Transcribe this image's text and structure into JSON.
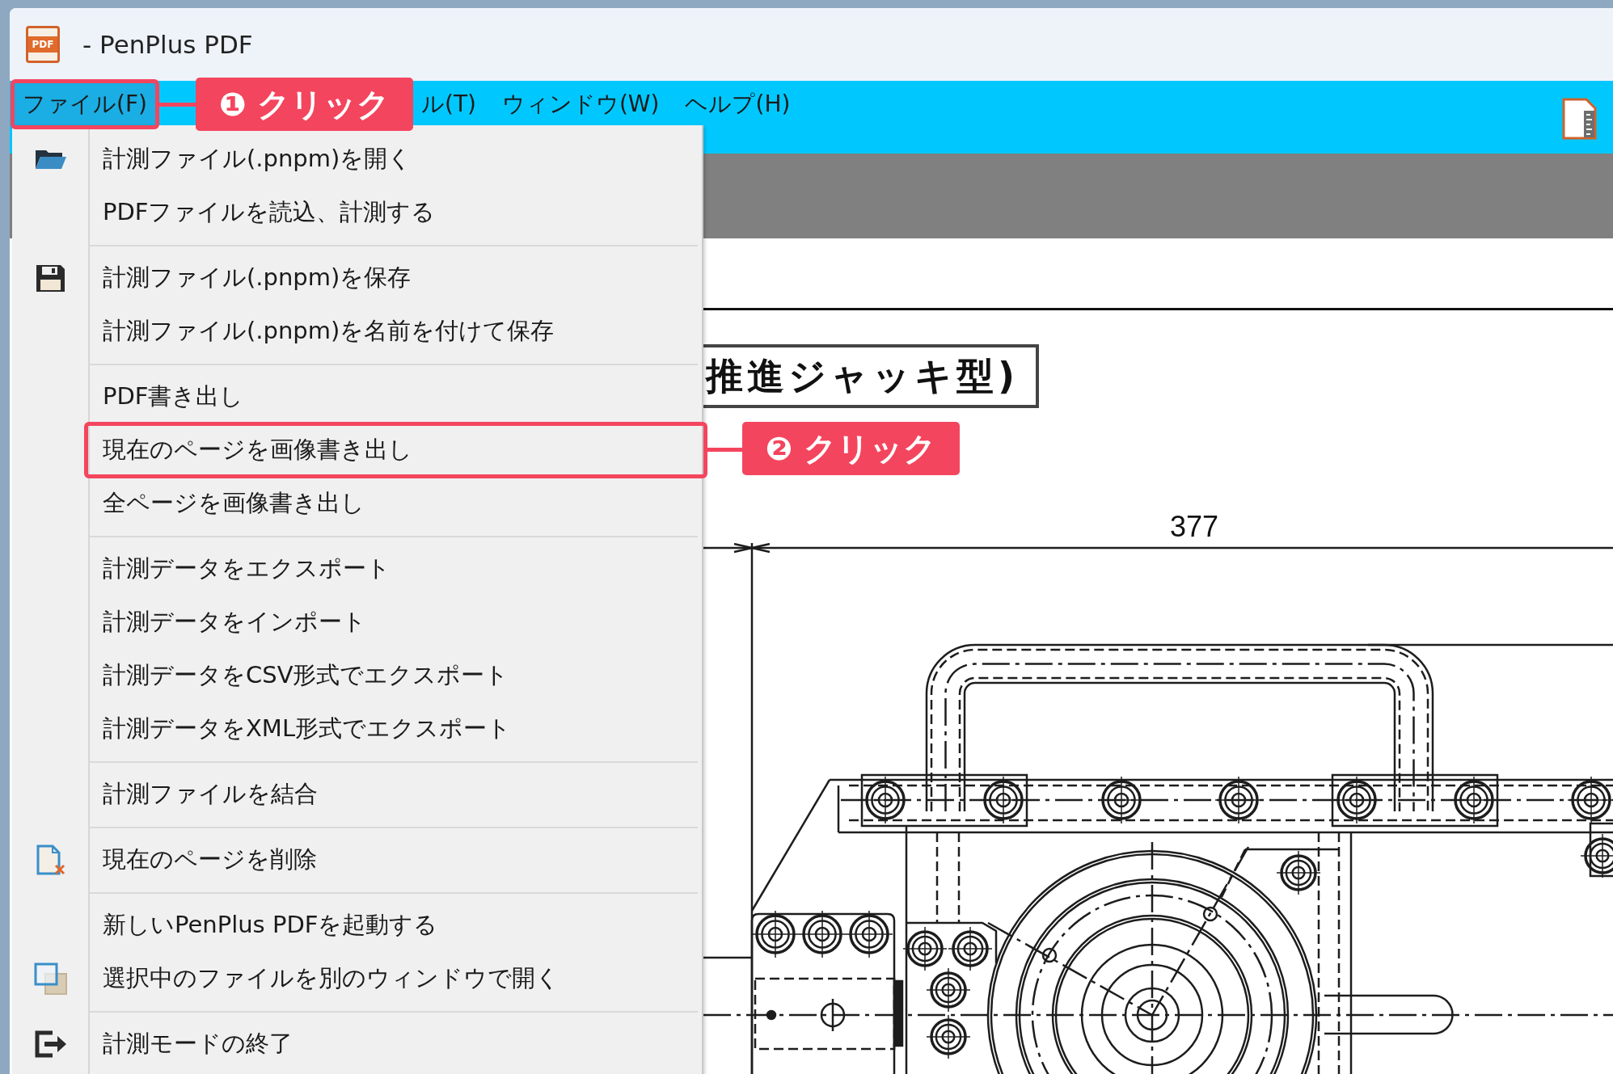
{
  "window": {
    "title": "- PenPlus PDF",
    "icon_label": "PDF"
  },
  "menubar": {
    "items": [
      {
        "label": "ファイル(F)",
        "selected": true,
        "callout": "❶ クリック"
      },
      {
        "label": "ル(T)",
        "selected": false
      },
      {
        "label": "ウィンドウ(W)",
        "selected": false
      },
      {
        "label": "ヘルプ(H)",
        "selected": false
      }
    ]
  },
  "file_menu": {
    "groups": [
      {
        "items": [
          {
            "label": "計測ファイル(.pnpm)を開く"
          },
          {
            "label": "PDFファイルを読込、計測する"
          }
        ]
      },
      {
        "items": [
          {
            "label": "計測ファイル(.pnpm)を保存"
          },
          {
            "label": "計測ファイル(.pnpm)を名前を付けて保存"
          }
        ]
      },
      {
        "items": [
          {
            "label": "PDF書き出し"
          },
          {
            "label": "現在のページを画像書き出し",
            "callout": "❷ クリック"
          },
          {
            "label": "全ページを画像書き出し"
          }
        ]
      },
      {
        "items": [
          {
            "label": "計測データをエクスポート"
          },
          {
            "label": "計測データをインポート"
          },
          {
            "label": "計測データをCSV形式でエクスポート"
          },
          {
            "label": "計測データをXML形式でエクスポート"
          }
        ]
      },
      {
        "items": [
          {
            "label": "計測ファイルを結合"
          }
        ]
      },
      {
        "items": [
          {
            "label": "現在のページを削除"
          }
        ]
      },
      {
        "items": [
          {
            "label": "新しいPenPlus PDFを起動する"
          },
          {
            "label": "選択中のファイルを別のウィンドウで開く"
          }
        ]
      },
      {
        "items": [
          {
            "label": "計測モードの終了"
          }
        ]
      }
    ]
  },
  "document": {
    "title": "推進ジャッキ型)",
    "dimension": "377"
  }
}
